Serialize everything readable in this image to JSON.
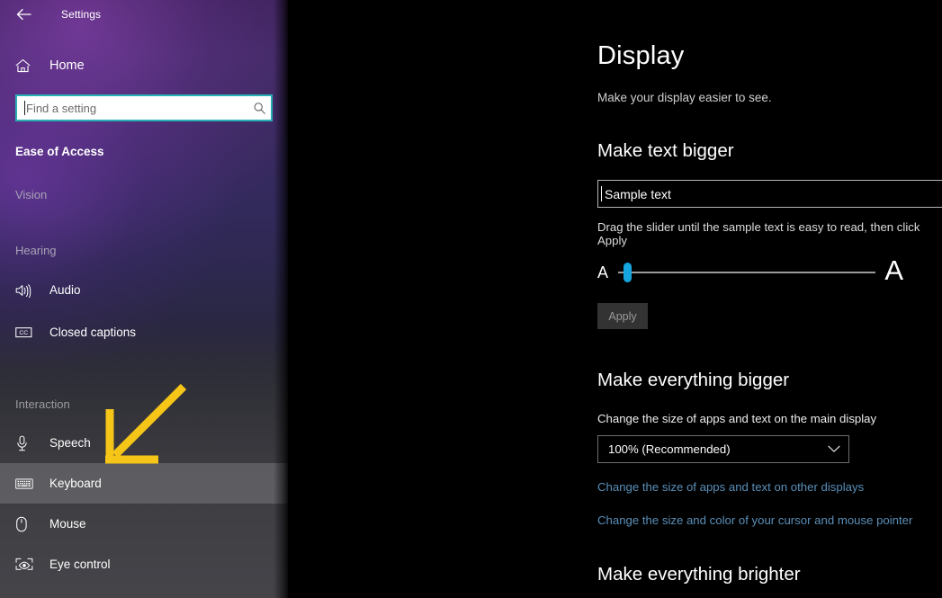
{
  "window": {
    "title": "Settings",
    "back_icon": "back-arrow-icon"
  },
  "sidebar": {
    "home": {
      "label": "Home",
      "icon": "home-icon"
    },
    "search": {
      "placeholder": "Find a setting",
      "value": "",
      "icon": "search-icon"
    },
    "category": "Ease of Access",
    "groups": [
      {
        "label": "Vision",
        "items": []
      },
      {
        "label": "Hearing",
        "items": [
          {
            "label": "Audio",
            "icon": "speaker-icon",
            "selected": false
          },
          {
            "label": "Closed captions",
            "icon": "closed-captions-icon",
            "selected": false
          }
        ]
      },
      {
        "label": "Interaction",
        "items": [
          {
            "label": "Speech",
            "icon": "microphone-icon",
            "selected": false
          },
          {
            "label": "Keyboard",
            "icon": "keyboard-icon",
            "selected": true
          },
          {
            "label": "Mouse",
            "icon": "mouse-icon",
            "selected": false
          },
          {
            "label": "Eye control",
            "icon": "eye-control-icon",
            "selected": false
          }
        ]
      }
    ]
  },
  "annotation": {
    "type": "arrow",
    "color": "#f5c518",
    "points_to": "Keyboard"
  },
  "main": {
    "title": "Display",
    "subtitle": "Make your display easier to see.",
    "sections": [
      {
        "heading": "Make text bigger",
        "sample_value": "Sample text",
        "hint": "Drag the slider until the sample text is easy to read, then click Apply",
        "slider": {
          "min_label": "A",
          "max_label": "A",
          "value_percent": 2
        },
        "apply_label": "Apply"
      },
      {
        "heading": "Make everything bigger",
        "field_label": "Change the size of apps and text on the main display",
        "dropdown_value": "100% (Recommended)",
        "dropdown_icon": "chevron-down-icon",
        "links": [
          "Change the size of apps and text on other displays",
          "Change the size and color of your cursor and mouse pointer"
        ]
      },
      {
        "heading": "Make everything brighter"
      }
    ]
  },
  "colors": {
    "accent_teal": "#29b0b4",
    "slider_blue": "#17a5e0",
    "link_blue": "#5a8fb8",
    "annotation_yellow": "#f5c518"
  }
}
